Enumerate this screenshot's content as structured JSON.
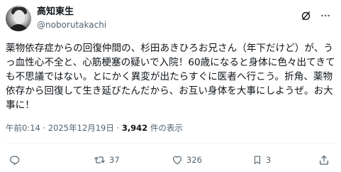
{
  "post": {
    "author_name": "高知東生",
    "author_handle": "@noborutakachi",
    "text": "薬物依存症からの回復仲間の、杉田あきひろお兄さん（年下だけど）が、うっ血性心不全と、心筋梗塞の疑いで入院！60歳になると身体に色々出てきても不思議ではない。とにかく異変が出たらすぐに医者へ行こう。折角、薬物依存から回復して生き延びたんだから、お互い身体を大事にしようぜ。お大事に！",
    "time": "午前0:14",
    "date": "2025年12月19日",
    "separator": "·",
    "views_count": "3,942",
    "views_label": "件の表示"
  },
  "actions": {
    "reply_count": "",
    "repost_count": "37",
    "like_count": "326",
    "bookmark_count": "3"
  },
  "icons": {
    "grok": "grok-icon",
    "more": "more-icon",
    "reply": "reply-icon",
    "repost": "repost-icon",
    "like": "like-icon",
    "bookmark": "bookmark-icon",
    "share": "share-icon"
  },
  "colors": {
    "text": "#0f1419",
    "secondary": "#536471",
    "divider": "#eff3f4"
  }
}
